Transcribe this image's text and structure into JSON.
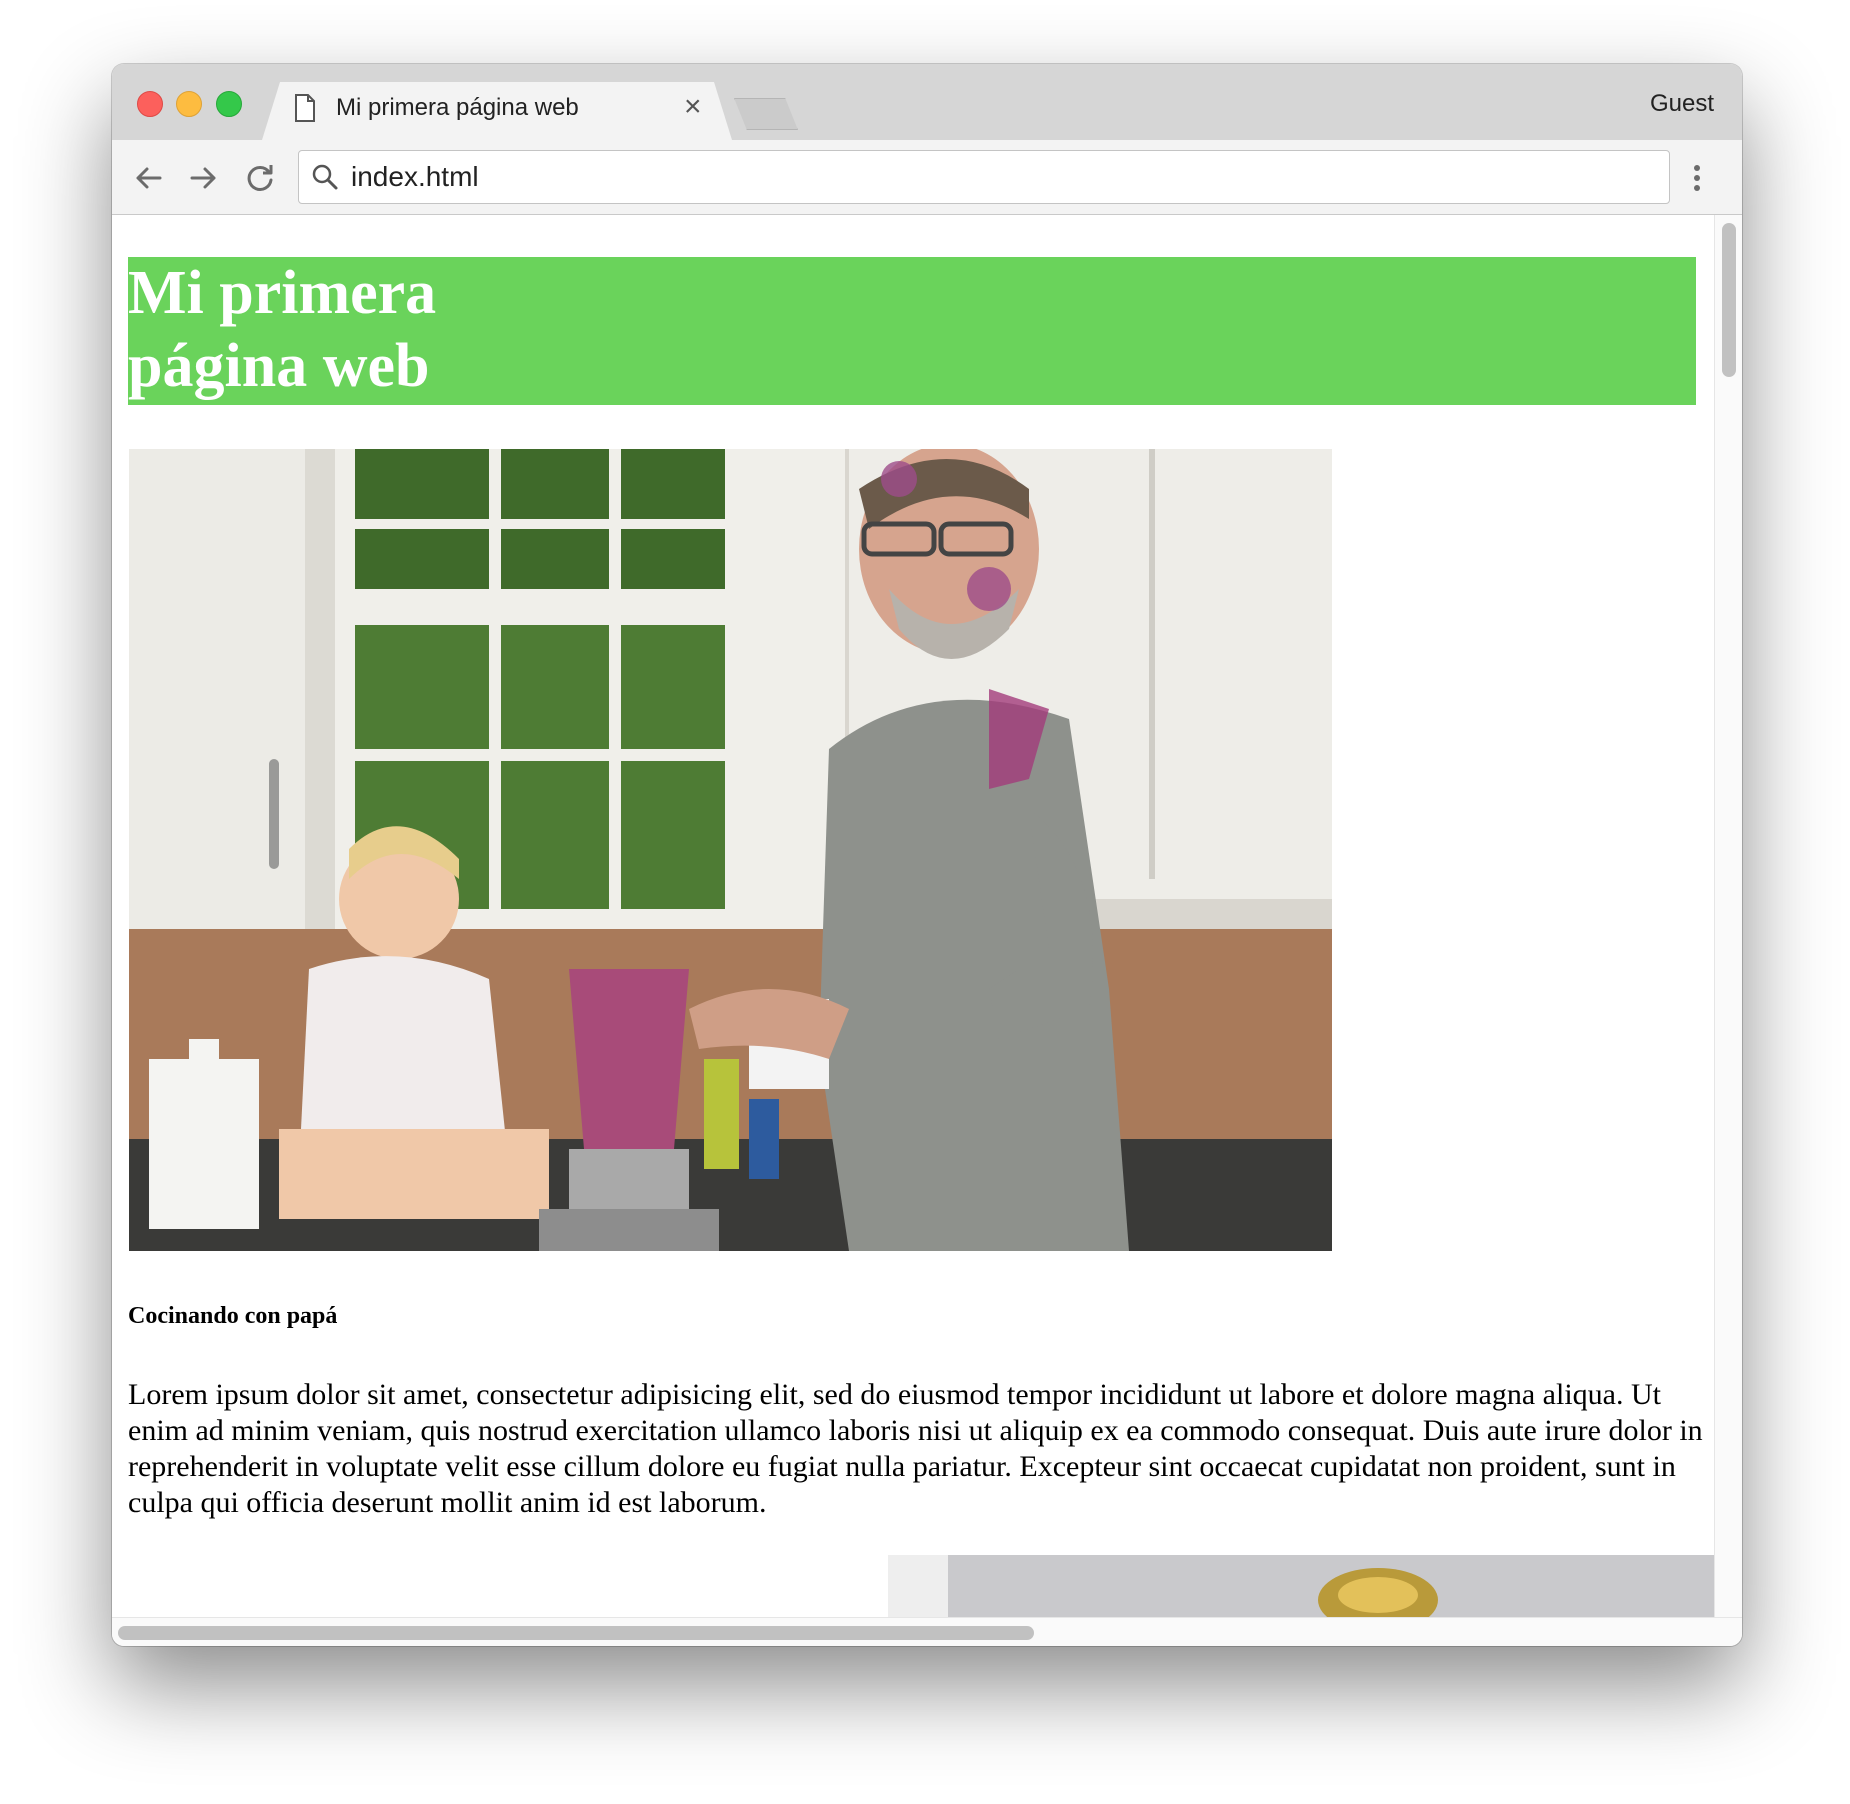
{
  "browser": {
    "tab_title": "Mi primera página web",
    "close_glyph": "×",
    "profile_label": "Guest",
    "address": "index.html",
    "icons": {
      "back": "arrow-left-icon",
      "forward": "arrow-right-icon",
      "reload": "reload-icon",
      "search": "search-icon",
      "menu": "more-vertical-icon",
      "document": "document-icon"
    }
  },
  "page": {
    "heading": "Mi primera página web",
    "heading_bg": "#6ad35b",
    "caption": "Cocinando con papá",
    "body_text": "Lorem ipsum dolor sit amet, consectetur adipisicing elit, sed do eiusmod tempor incididunt ut labore et dolore magna aliqua. Ut enim ad minim veniam, quis nostrud exercitation ullamco laboris nisi ut aliquip ex ea commodo consequat. Duis aute irure dolor in reprehenderit in voluptate velit esse cillum dolore eu fugiat nulla pariatur. Excepteur sint occaecat cupidatat non proident, sunt in culpa qui officia deserunt mollit anim id est laborum."
  }
}
